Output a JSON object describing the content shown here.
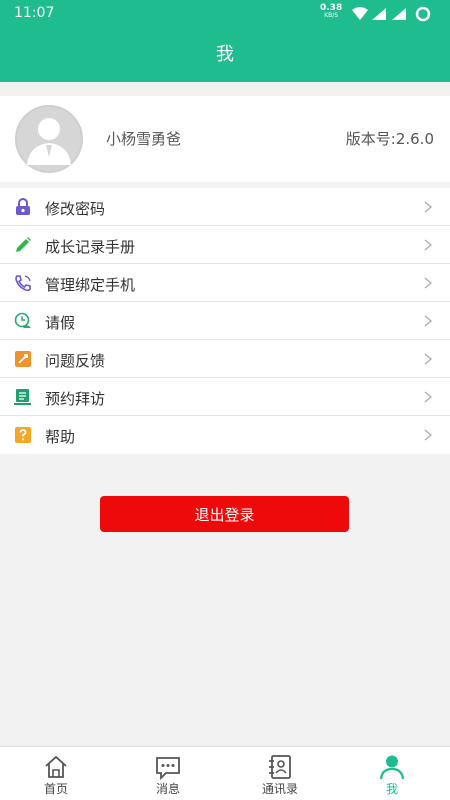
{
  "status_bar": {
    "time": "11:07",
    "speed_value": "0.38",
    "speed_unit": "KB/S"
  },
  "header": {
    "title": "我"
  },
  "profile": {
    "username": "小杨雪勇爸",
    "version": "版本号:2.6.0"
  },
  "menu": {
    "items": [
      {
        "label": "修改密码",
        "icon": "lock-icon",
        "color": "#6a5acd"
      },
      {
        "label": "成长记录手册",
        "icon": "pencil-icon",
        "color": "#2db84d"
      },
      {
        "label": "管理绑定手机",
        "icon": "phone-icon",
        "color": "#6a5acd"
      },
      {
        "label": "请假",
        "icon": "leave-request-icon",
        "color": "#2aa876"
      },
      {
        "label": "问题反馈",
        "icon": "feedback-icon",
        "color": "#f0922b"
      },
      {
        "label": "预约拜访",
        "icon": "appointment-icon",
        "color": "#1fa06e"
      },
      {
        "label": "帮助",
        "icon": "help-icon",
        "color": "#f5a623"
      }
    ]
  },
  "logout_label": "退出登录",
  "tabs": [
    {
      "label": "首页",
      "icon": "home-icon",
      "active": false
    },
    {
      "label": "消息",
      "icon": "message-icon",
      "active": false
    },
    {
      "label": "通讯录",
      "icon": "contacts-icon",
      "active": false
    },
    {
      "label": "我",
      "icon": "me-icon",
      "active": true
    }
  ],
  "colors": {
    "primary": "#1fbc8f",
    "logout": "#ee0a0a"
  }
}
